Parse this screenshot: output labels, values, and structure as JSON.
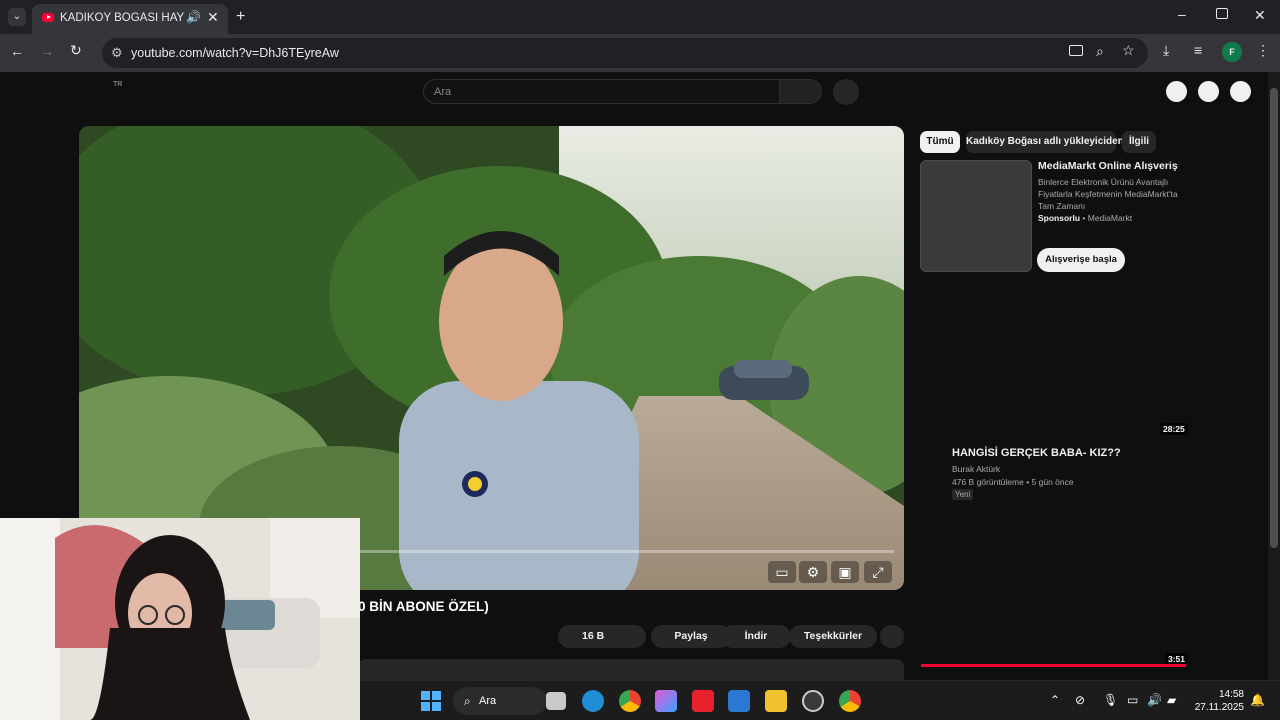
{
  "browser": {
    "tab_title": "KADIKÖY BOĞASI HAYRETTİN",
    "url": "youtube.com/watch?v=DhJ6TEyreAw",
    "profile_initial": "F"
  },
  "youtube": {
    "country_code": "TR",
    "search_placeholder": "Ara",
    "video_title": "0 BİN ABONE ÖZEL)",
    "actions": {
      "likes": "16 B",
      "share": "Paylaş",
      "download": "İndir",
      "thanks": "Teşekkürler"
    },
    "chips": [
      "Tümü",
      "Kadıköy Boğası adlı yükleyiciden",
      "İlgili"
    ],
    "ad": {
      "title": "MediaMarkt Online Alışveriş",
      "description": "Binlerce Elektronik Ürünü Avantajlı Fiyatlarla Keşfetmenin MediaMarkt'ta Tam Zamanı",
      "sponsored": "Sponsorlu",
      "advertiser": "MediaMarkt",
      "cta": "Alışverişe başla"
    },
    "recommendations": [
      {
        "duration": "28:25",
        "title": "HANGİSİ GERÇEK BABA- KIZ??",
        "channel": "Burak Aktürk",
        "meta": "476 B görüntüleme • 5 gün önce",
        "badge": "Yeni"
      },
      {
        "duration": "3:51"
      }
    ]
  },
  "taskbar": {
    "search_label": "Ara",
    "time": "14:58",
    "date": "27.11.2025"
  },
  "colors": {
    "youtube_red": "#ff0033",
    "page_bg": "#0f0f0f",
    "chip_active_bg": "#f1f1f1"
  }
}
